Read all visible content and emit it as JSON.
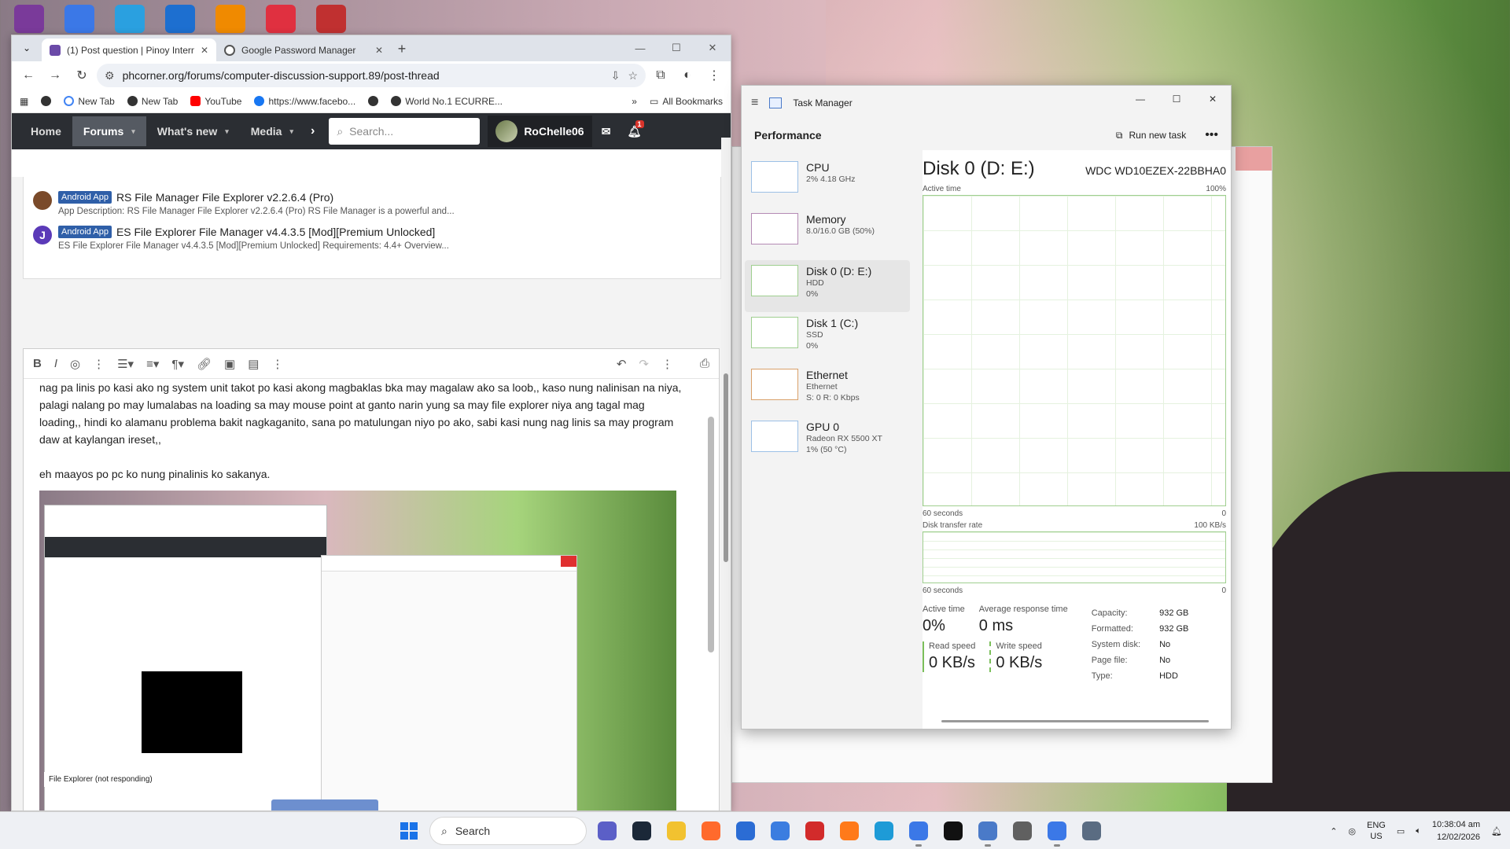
{
  "desktop": {
    "icons": [
      {
        "icon": "winrar-icon",
        "color": "#7a3a9a"
      },
      {
        "icon": "chrome-icon",
        "color": "#3b78e7"
      },
      {
        "icon": "browser-icon",
        "color": "#2aa0e0"
      },
      {
        "icon": "app-icon",
        "color": "#1d6fd0"
      },
      {
        "icon": "vlc-icon",
        "color": "#f08a00"
      },
      {
        "icon": "app-icon",
        "color": "#e03040"
      },
      {
        "icon": "app-icon",
        "color": "#c03030"
      }
    ]
  },
  "chrome": {
    "tabs": [
      {
        "label": "(1) Post question | Pinoy Interne",
        "active": true
      },
      {
        "label": "Google Password Manager",
        "active": false
      }
    ],
    "new_tab": "+",
    "url": "phcorner.org/forums/computer-discussion-support.89/post-thread",
    "bookmarks": [
      {
        "label": "",
        "icon": "circle-icon"
      },
      {
        "label": "New Tab",
        "icon": "google-icon"
      },
      {
        "label": "New Tab",
        "icon": "circle-icon"
      },
      {
        "label": "YouTube",
        "icon": "youtube-icon"
      },
      {
        "label": "https://www.facebo...",
        "icon": "facebook-icon"
      },
      {
        "label": "",
        "icon": "circle-icon"
      },
      {
        "label": "World No.1 ECURRE...",
        "icon": "circle-icon"
      }
    ],
    "bookmarks_more": "»",
    "all_bookmarks": "All Bookmarks"
  },
  "forum": {
    "nav": [
      {
        "label": "Home",
        "caret": false,
        "active": false
      },
      {
        "label": "Forums",
        "caret": true,
        "active": true
      },
      {
        "label": "What's new",
        "caret": true,
        "active": false
      },
      {
        "label": "Media",
        "caret": true,
        "active": false
      }
    ],
    "search_placeholder": "Search...",
    "username": "RoChelle06",
    "alerts_count": "1",
    "similar_threads": [
      {
        "label": "Android App",
        "title": "RS File Manager File Explorer v2.2.6.4 (Pro)",
        "desc": "App Description: RS File Manager File Explorer v2.2.6.4 (Pro) RS File Manager is a powerful and..."
      },
      {
        "label": "Android App",
        "title": "ES File Explorer File Manager v4.4.3.5 [Mod][Premium Unlocked]",
        "desc": "ES File Explorer File Manager v4.4.3.5 [Mod][Premium Unlocked] Requirements: 4.4+ Overview..."
      }
    ],
    "editor_paragraphs": [
      "nag pa linis po kasi ako ng system unit takot po kasi akong magbaklas bka may magalaw ako sa loob,, kaso nung nalinisan na niya, palagi nalang po may lumalabas na loading sa may mouse point at ganto narin yung sa may file explorer niya ang tagal mag loading,, hindi ko alamanu problema bakit nagkaganito, sana po matulungan niyo po ako, sabi kasi nung nag linis sa may program daw at kaylangan ireset,,",
      "eh maayos po pc ko nung pinalinis ko sakanya."
    ],
    "embedded_caption": "File Explorer (not responding)"
  },
  "task_manager": {
    "title": "Task Manager",
    "section": "Performance",
    "run_new_task": "Run new task",
    "more": "•••",
    "sidebar": [
      {
        "name": "CPU",
        "sub1": "2% 4.18 GHz",
        "sub2": "",
        "sub3": "",
        "kind": "cpu"
      },
      {
        "name": "Memory",
        "sub1": "8.0/16.0 GB (50%)",
        "sub2": "",
        "sub3": "",
        "kind": "mem"
      },
      {
        "name": "Disk 0 (D: E:)",
        "sub1": "HDD",
        "sub2": "0%",
        "sub3": "",
        "kind": "disk"
      },
      {
        "name": "Disk 1 (C:)",
        "sub1": "SSD",
        "sub2": "0%",
        "sub3": "",
        "kind": "disk"
      },
      {
        "name": "Ethernet",
        "sub1": "Ethernet",
        "sub2": "S: 0 R: 0 Kbps",
        "sub3": "",
        "kind": "eth"
      },
      {
        "name": "GPU 0",
        "sub1": "Radeon RX 5500 XT",
        "sub2": "1% (50 °C)",
        "sub3": "",
        "kind": "cpu"
      }
    ],
    "disk_title": "Disk 0 (D: E:)",
    "disk_model": "WDC WD10EZEX-22BBHA0",
    "active_time_label": "Active time",
    "active_time_max": "100%",
    "seconds_label": "60 seconds",
    "zero": "0",
    "transfer_label": "Disk transfer rate",
    "transfer_max": "100 KB/s",
    "stats": {
      "active_time": "Active time",
      "active_time_value": "0%",
      "avg_response": "Average response time",
      "avg_response_value": "0 ms",
      "read_speed": "Read speed",
      "read_speed_value": "0 KB/s",
      "write_speed": "Write speed",
      "write_speed_value": "0 KB/s"
    },
    "properties": [
      {
        "k": "Capacity:",
        "v": "932 GB"
      },
      {
        "k": "Formatted:",
        "v": "932 GB"
      },
      {
        "k": "System disk:",
        "v": "No"
      },
      {
        "k": "Page file:",
        "v": "No"
      },
      {
        "k": "Type:",
        "v": "HDD"
      }
    ]
  },
  "taskbar": {
    "search_label": "Search",
    "apps": [
      {
        "icon": "meet-icon",
        "color": "#5b5fc7",
        "running": false
      },
      {
        "icon": "steam-icon",
        "color": "#1b2838",
        "running": false
      },
      {
        "icon": "folder-icon",
        "color": "#f2c230",
        "running": false
      },
      {
        "icon": "app-icon",
        "color": "#ff6a2c",
        "running": false
      },
      {
        "icon": "store-icon",
        "color": "#2b6cd4",
        "running": false
      },
      {
        "icon": "app-icon",
        "color": "#3b7de0",
        "running": false
      },
      {
        "icon": "wps-icon",
        "color": "#d22b2b",
        "running": false
      },
      {
        "icon": "firefox-icon",
        "color": "#ff7a1a",
        "running": false
      },
      {
        "icon": "edge-icon",
        "color": "#1e9bd7",
        "running": false
      },
      {
        "icon": "chrome-icon",
        "color": "#3b78e7",
        "running": true
      },
      {
        "icon": "capcut-icon",
        "color": "#111111",
        "running": false
      },
      {
        "icon": "task-manager-icon",
        "color": "#4a7ac8",
        "running": true
      },
      {
        "icon": "app-icon",
        "color": "#606060",
        "running": false
      },
      {
        "icon": "chrome-icon",
        "color": "#3b78e7",
        "running": true
      },
      {
        "icon": "settings-icon",
        "color": "#5a6c82",
        "running": false
      }
    ],
    "lang_top": "ENG",
    "lang_bottom": "US",
    "time": "10:38:04 am",
    "date": "12/02/2026"
  }
}
